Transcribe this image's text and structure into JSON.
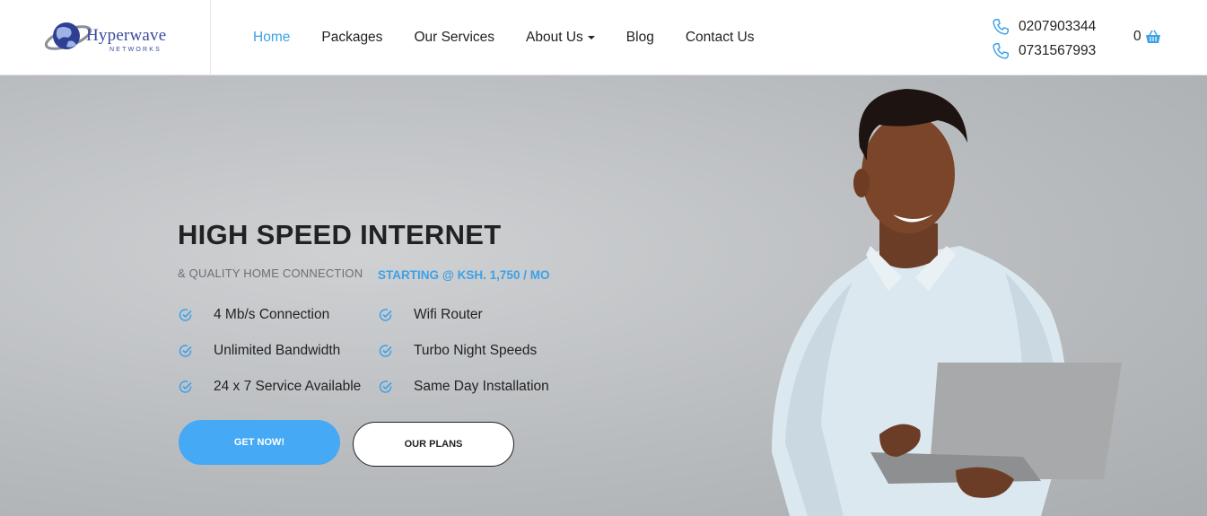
{
  "header": {
    "logo": {
      "name": "Hyperwave",
      "tagline": "NETWORKS",
      "icon": "globe-logo-icon"
    },
    "nav": [
      {
        "label": "Home",
        "active": true
      },
      {
        "label": "Packages",
        "active": false
      },
      {
        "label": "Our Services",
        "active": false
      },
      {
        "label": "About Us",
        "active": false,
        "has_dropdown": true
      },
      {
        "label": "Blog",
        "active": false
      },
      {
        "label": "Contact Us",
        "active": false
      }
    ],
    "phones": [
      {
        "number": "0207903344",
        "icon": "phone-icon"
      },
      {
        "number": "0731567993",
        "icon": "phone-icon"
      }
    ],
    "cart": {
      "count": "0",
      "icon": "basket-icon"
    }
  },
  "hero": {
    "title": "HIGH SPEED INTERNET",
    "subtitle": "& QUALITY HOME CONNECTION",
    "price": "STARTING @ KSH. 1,750 / MO",
    "features": [
      "4 Mb/s Connection",
      "Wifi Router",
      "Unlimited Bandwidth",
      "Turbo Night Speeds",
      "24 x 7 Service Available",
      "Same Day Installation"
    ],
    "feature_icon": "check-circle-icon",
    "buttons": {
      "primary": "GET NOW!",
      "secondary": "OUR PLANS"
    }
  },
  "colors": {
    "accent": "#3da1e8",
    "button": "#45a9f5",
    "text": "#222222",
    "muted": "#6d6f72"
  }
}
